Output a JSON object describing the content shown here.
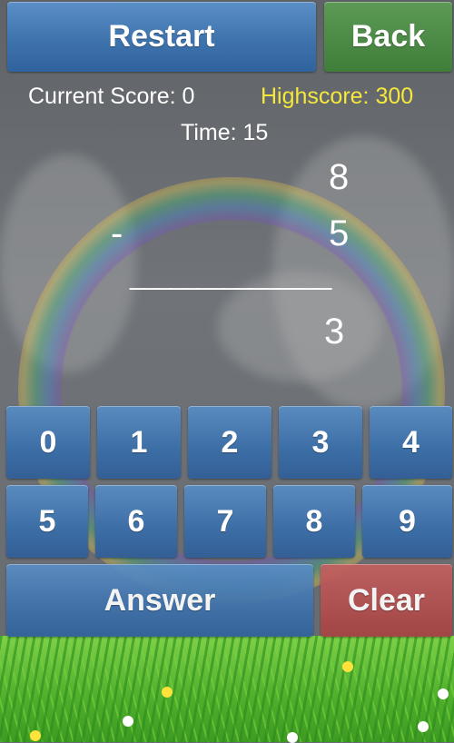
{
  "top_bar": {
    "restart_label": "Restart",
    "back_label": "Back"
  },
  "status": {
    "current_score_text": "Current Score: 0",
    "highscore_text": "Highscore: 300",
    "time_text": "Time: 15"
  },
  "problem": {
    "top_number": "8",
    "operator": "-",
    "bottom_number": "5",
    "divider": "_______________",
    "answer_entry": "3"
  },
  "keypad": {
    "row1": [
      "0",
      "1",
      "2",
      "3",
      "4"
    ],
    "row2": [
      "5",
      "6",
      "7",
      "8",
      "9"
    ]
  },
  "actions": {
    "answer_label": "Answer",
    "clear_label": "Clear"
  },
  "colors": {
    "highscore": "#f5e83a",
    "button_blue": "#3f73ad",
    "button_green": "#3f7d3a",
    "button_red": "#a84242"
  }
}
